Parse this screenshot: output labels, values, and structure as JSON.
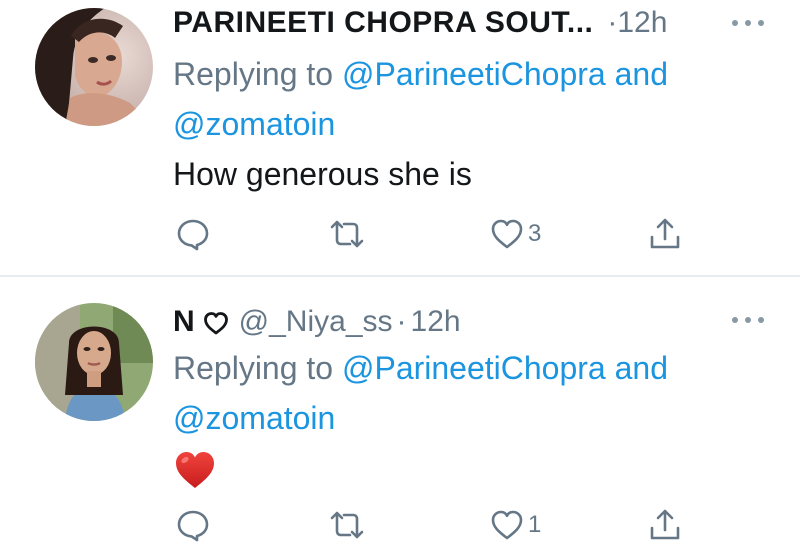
{
  "tweets": [
    {
      "name": "PARINEETI CHOPRA SOUT...",
      "separator": "·",
      "time": "12h",
      "reply_prefix": "Replying to",
      "mention_1": "@ParineetiChopra",
      "reply_and": "and",
      "mention_2": "@zomatoin",
      "text": "How generous she is",
      "like_count": "3",
      "avatar": "woman-portrait-avatar"
    },
    {
      "name": "N",
      "name_badge_icon": "heart-outline-icon",
      "handle": "@_Niya_ss",
      "separator": "·",
      "time": "12h",
      "reply_prefix": "Replying to",
      "mention_1": "@ParineetiChopra",
      "reply_and": "and",
      "mention_2": "@zomatoin",
      "text_emoji": "red-heart-emoji",
      "like_count": "1",
      "avatar": "woman-portrait-avatar"
    }
  ],
  "colors": {
    "text": "#14171a",
    "secondary": "#657786",
    "link": "#1b95e0",
    "icon": "#657786",
    "divider": "#e6ecf0",
    "heart": "#e0245e"
  }
}
